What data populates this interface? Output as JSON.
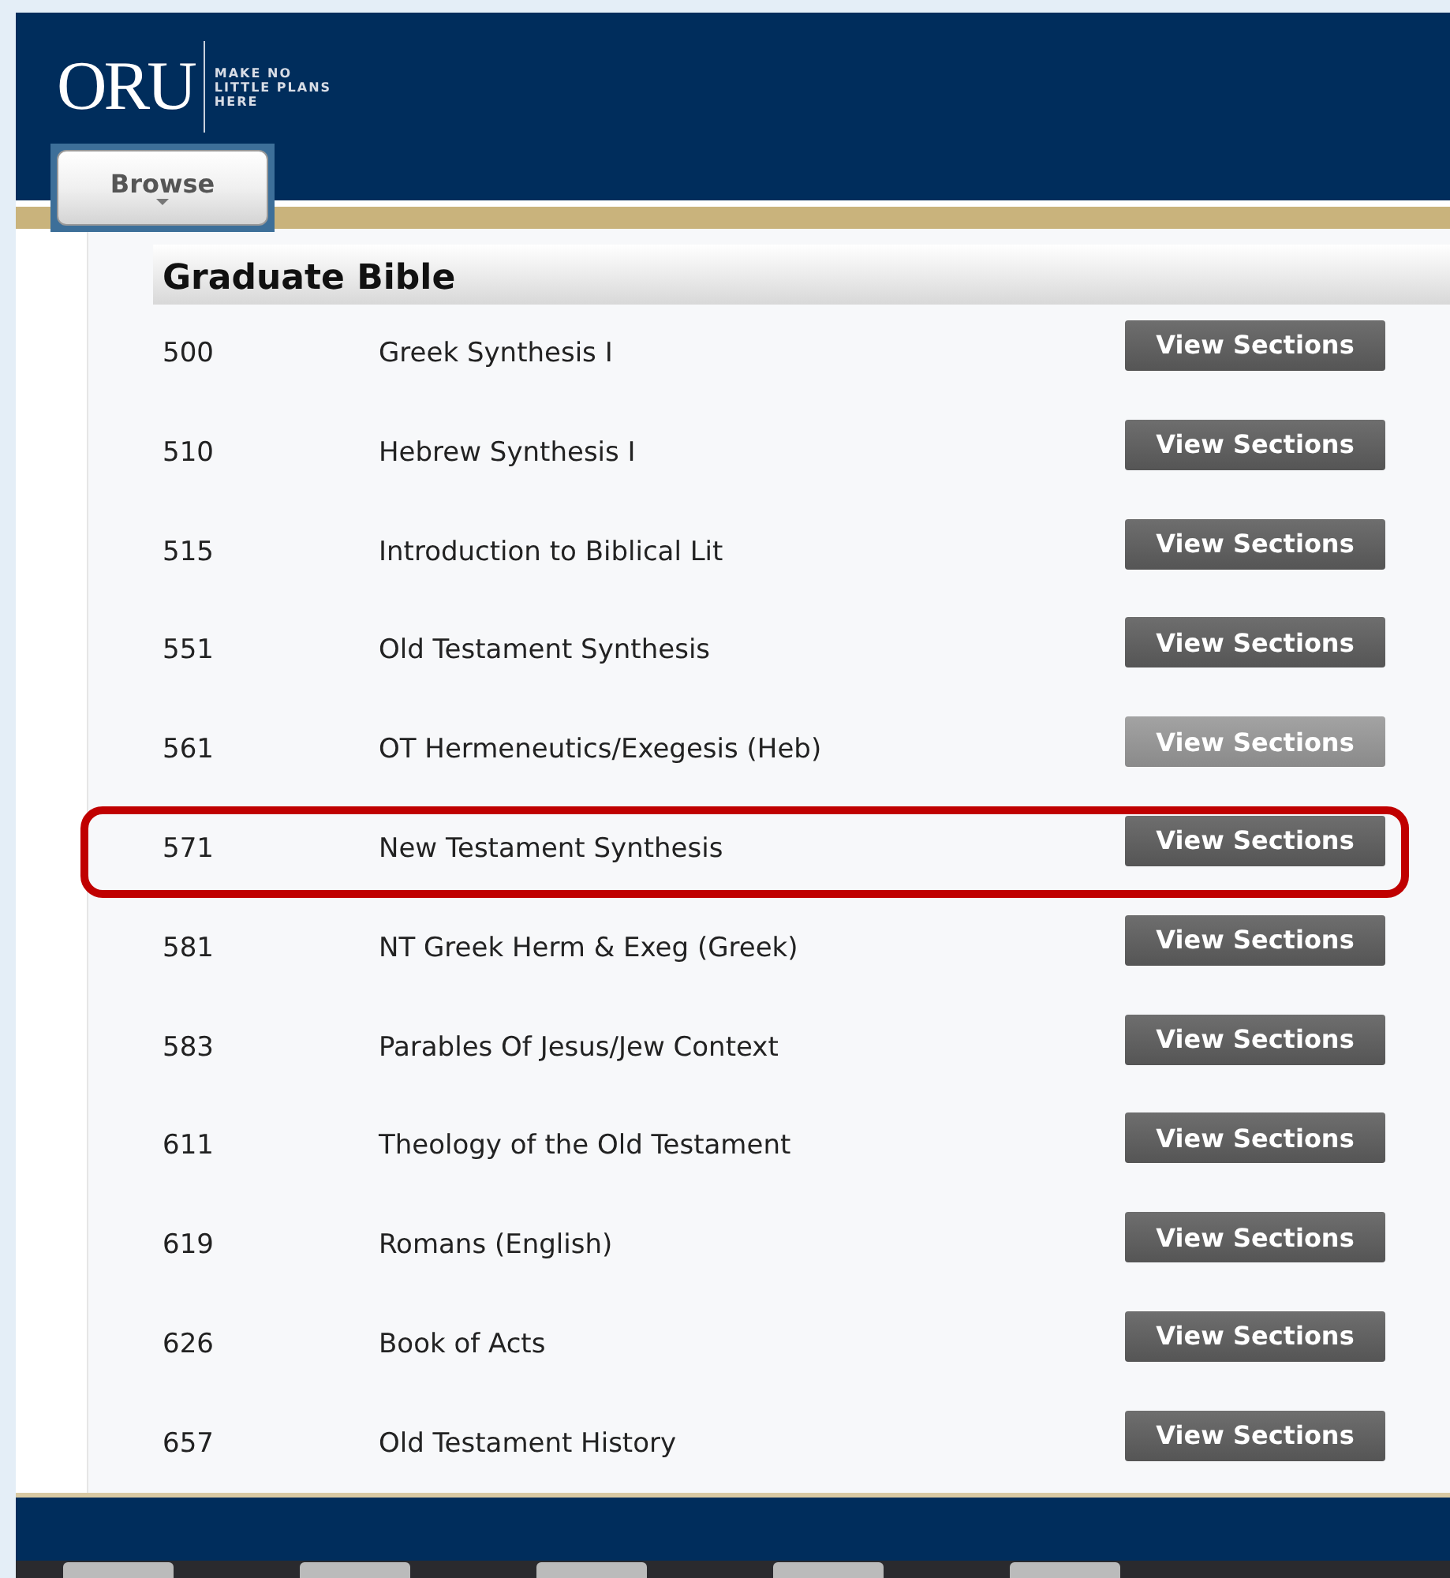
{
  "header": {
    "logo": "ORU",
    "tagline": [
      "MAKE NO",
      "LITTLE PLANS",
      "HERE"
    ],
    "browse_button": "Browse"
  },
  "section": {
    "title": "Graduate Bible"
  },
  "courses": [
    {
      "number": "500",
      "title": "Greek Synthesis I",
      "button": "View Sections",
      "hovered": false,
      "highlighted": false
    },
    {
      "number": "510",
      "title": "Hebrew Synthesis I",
      "button": "View Sections",
      "hovered": false,
      "highlighted": false
    },
    {
      "number": "515",
      "title": "Introduction to Biblical Lit",
      "button": "View Sections",
      "hovered": false,
      "highlighted": false
    },
    {
      "number": "551",
      "title": "Old Testament Synthesis",
      "button": "View Sections",
      "hovered": false,
      "highlighted": false
    },
    {
      "number": "561",
      "title": "OT Hermeneutics/Exegesis (Heb)",
      "button": "View Sections",
      "hovered": true,
      "highlighted": false
    },
    {
      "number": "571",
      "title": "New Testament Synthesis",
      "button": "View Sections",
      "hovered": false,
      "highlighted": true
    },
    {
      "number": "581",
      "title": "NT Greek Herm & Exeg (Greek)",
      "button": "View Sections",
      "hovered": false,
      "highlighted": false
    },
    {
      "number": "583",
      "title": "Parables Of Jesus/Jew Context",
      "button": "View Sections",
      "hovered": false,
      "highlighted": false
    },
    {
      "number": "611",
      "title": "Theology of the Old Testament",
      "button": "View Sections",
      "hovered": false,
      "highlighted": false
    },
    {
      "number": "619",
      "title": "Romans (English)",
      "button": "View Sections",
      "hovered": false,
      "highlighted": false
    },
    {
      "number": "626",
      "title": "Book of Acts",
      "button": "View Sections",
      "hovered": false,
      "highlighted": false
    },
    {
      "number": "657",
      "title": "Old Testament History",
      "button": "View Sections",
      "hovered": false,
      "highlighted": false
    }
  ]
}
